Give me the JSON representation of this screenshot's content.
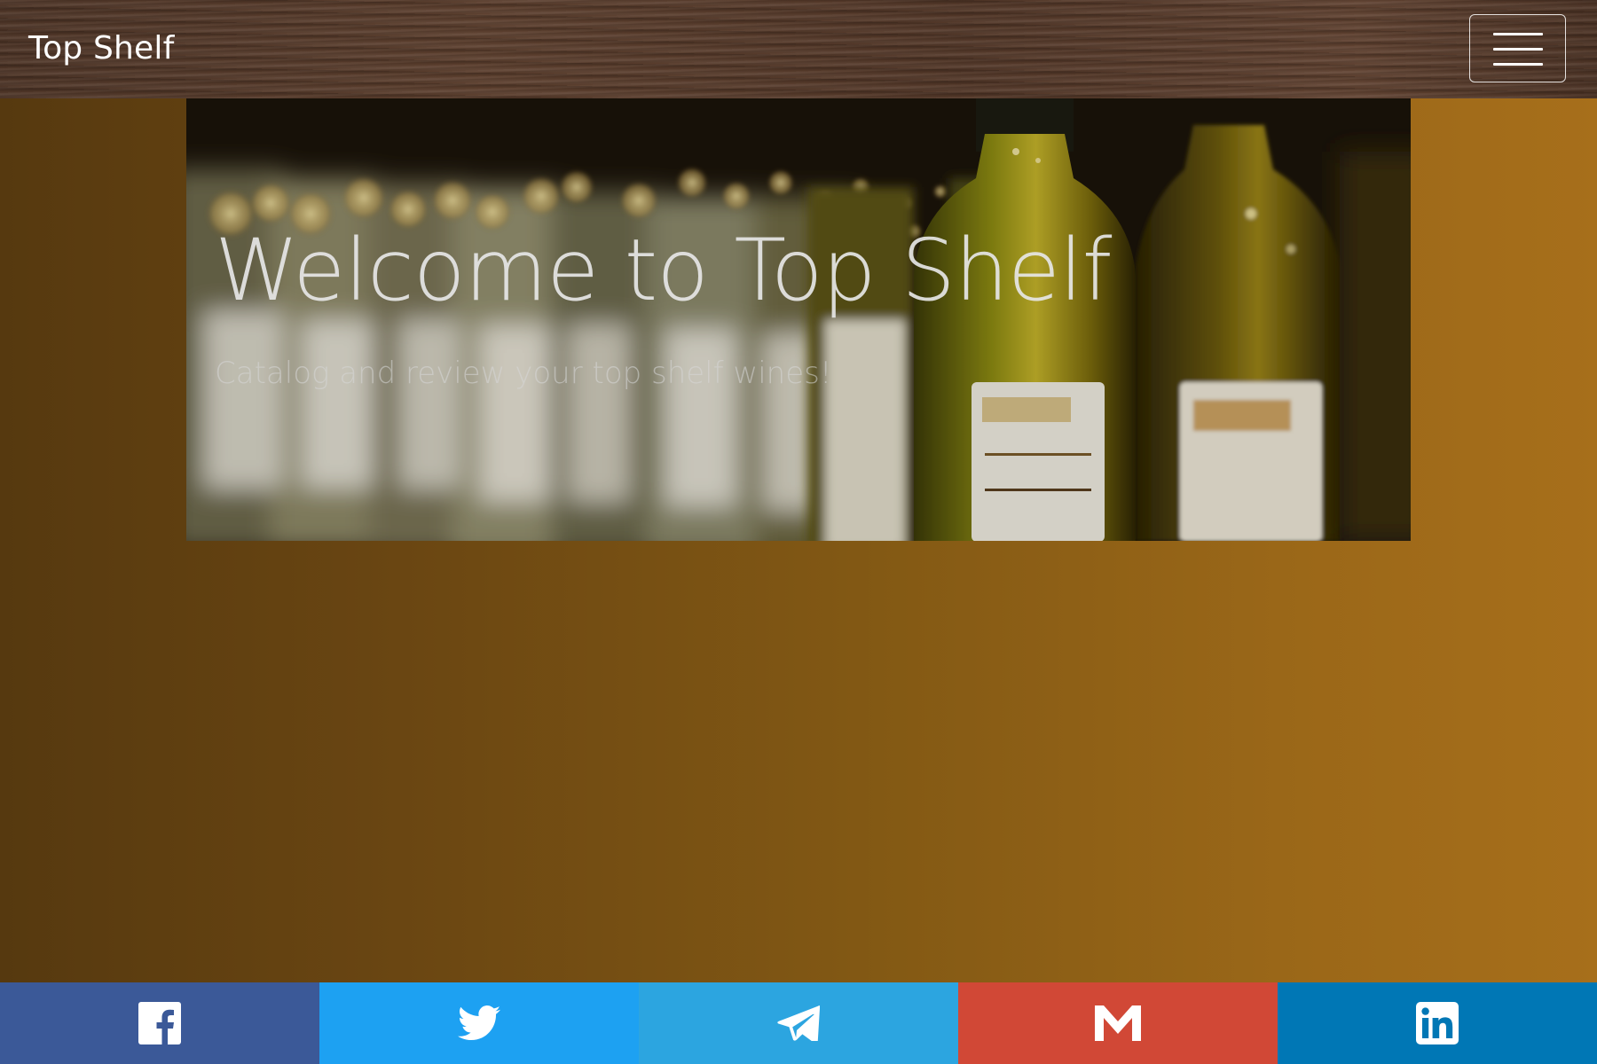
{
  "navbar": {
    "brand": "Top Shelf",
    "toggle_icon": "hamburger-menu-icon"
  },
  "hero": {
    "title": "Welcome to Top Shelf",
    "subtitle": "Catalog and review your top shelf wines!"
  },
  "share": {
    "buttons": [
      {
        "network": "facebook",
        "icon": "facebook-icon",
        "color": "#3b5998"
      },
      {
        "network": "twitter",
        "icon": "twitter-icon",
        "color": "#1da1f2"
      },
      {
        "network": "telegram",
        "icon": "telegram-icon",
        "color": "#2ca5e0"
      },
      {
        "network": "gmail",
        "icon": "gmail-icon",
        "color": "#d14836"
      },
      {
        "network": "linkedin",
        "icon": "linkedin-icon",
        "color": "#0077b5"
      }
    ]
  },
  "colors": {
    "background_start": "#56390f",
    "background_end": "#a76f1b",
    "navbar_wood": "#5b3e2d"
  }
}
